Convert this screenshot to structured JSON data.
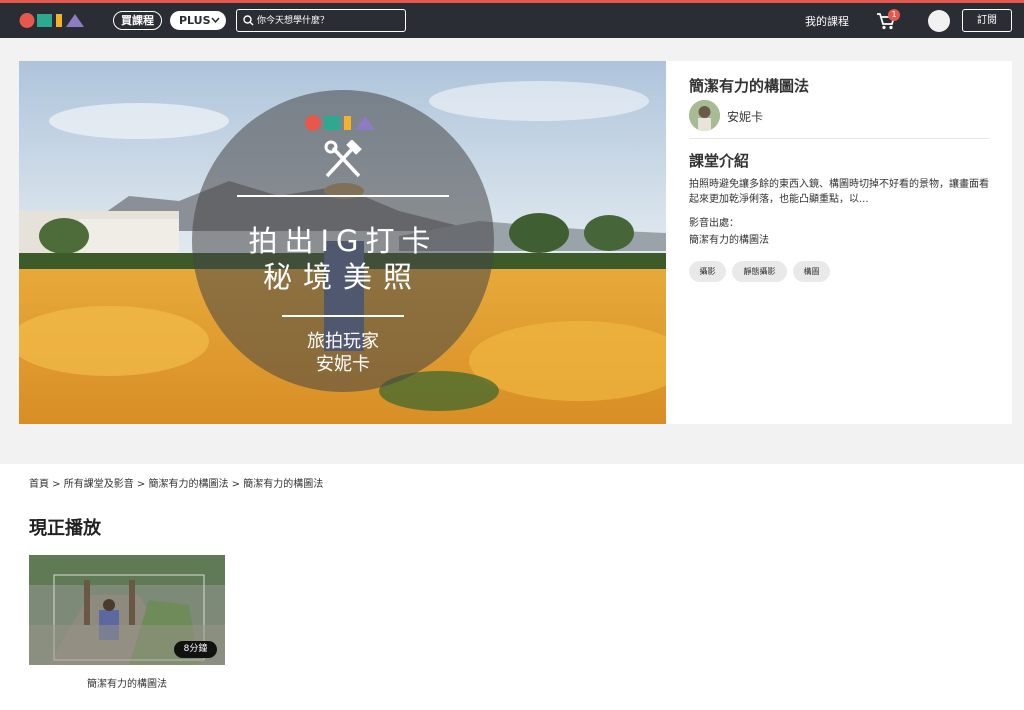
{
  "navbar": {
    "logo_icon": "omia-logo",
    "buy_label": "買課程",
    "plus_label": "PLUS",
    "search_placeholder": "你今天想學什麼？",
    "my_courses_label": "我的課程",
    "cart_icon": "cart-icon",
    "cart_count": "1",
    "subscribe_label": "訂閱",
    "accent_color": "#e5584b",
    "bar_color": "#2a2d34"
  },
  "hero": {
    "title_line1": "拍出IG打卡",
    "title_line2": "秘境美照",
    "subtitle_line1": "旅拍玩家",
    "subtitle_line2": "安妮卡"
  },
  "course": {
    "title": "簡潔有力的構圖法",
    "teacher_name": "安妮卡",
    "intro_heading": "課堂介紹",
    "intro_text": "拍照時避免讓多餘的東西入鏡、構圖時切掉不好看的景物，讓畫面看起來更加乾淨俐落，也能凸顯重點，以...",
    "source_label": "影音出處：",
    "source_value": "簡潔有力的構圖法",
    "tags": [
      "攝影",
      "靜態攝影",
      "構圖"
    ]
  },
  "breadcrumb": "首頁 > 所有課堂及影音 > 簡潔有力的構圖法 > 簡潔有力的構圖法",
  "now_playing": {
    "heading": "現正播放",
    "video_duration": "8分鐘",
    "video_title": "簡潔有力的構圖法"
  }
}
